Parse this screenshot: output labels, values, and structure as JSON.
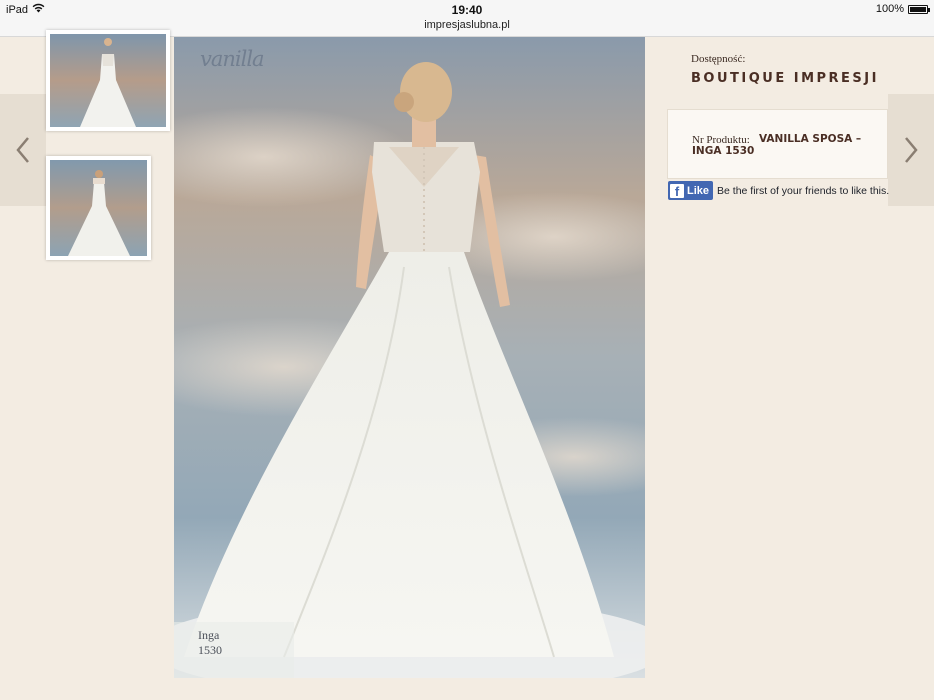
{
  "status_bar": {
    "device": "iPad",
    "time": "19:40",
    "url": "impresjaslubna.pl",
    "battery": "100%",
    "battery_level": 1.0
  },
  "gallery": {
    "brand": "vanilla",
    "caption_line1": "Inga",
    "caption_line2": "1530",
    "thumbnails": [
      "thumbnail-front",
      "thumbnail-back"
    ]
  },
  "product": {
    "availability_label": "Dostępność:",
    "availability_value": "BOUTIQUE IMPRESJI",
    "product_number_label": "Nr Produktu:",
    "product_number_value": "VANILLA SPOSA – INGA 1530"
  },
  "facebook": {
    "like_label": "Like",
    "social_text": "Be the first of your friends to like this."
  },
  "icons": {
    "prev": "chevron-left-icon",
    "next": "chevron-right-icon",
    "wifi": "wifi-icon",
    "battery": "battery-icon",
    "facebook": "facebook-icon"
  },
  "colors": {
    "page_background": "#f3ece2",
    "heading_brown": "#4a2e24",
    "facebook_blue": "#4267b2"
  }
}
